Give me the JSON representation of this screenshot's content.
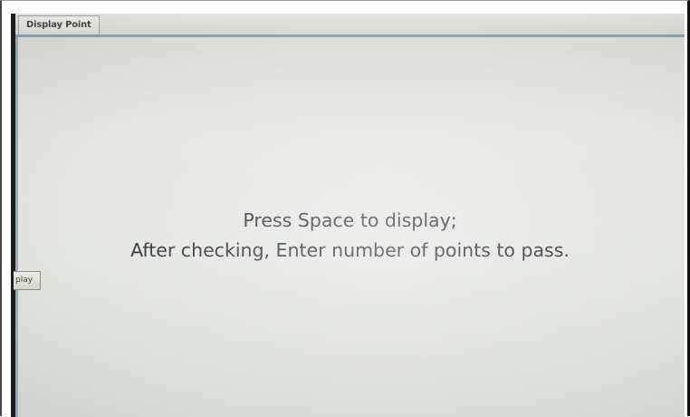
{
  "window": {
    "tab_label": "Display Point"
  },
  "main": {
    "instruction_line_1": "Press Space to display;",
    "instruction_line_2": "After checking, Enter number of points to pass."
  },
  "side_button": {
    "label": "play"
  }
}
